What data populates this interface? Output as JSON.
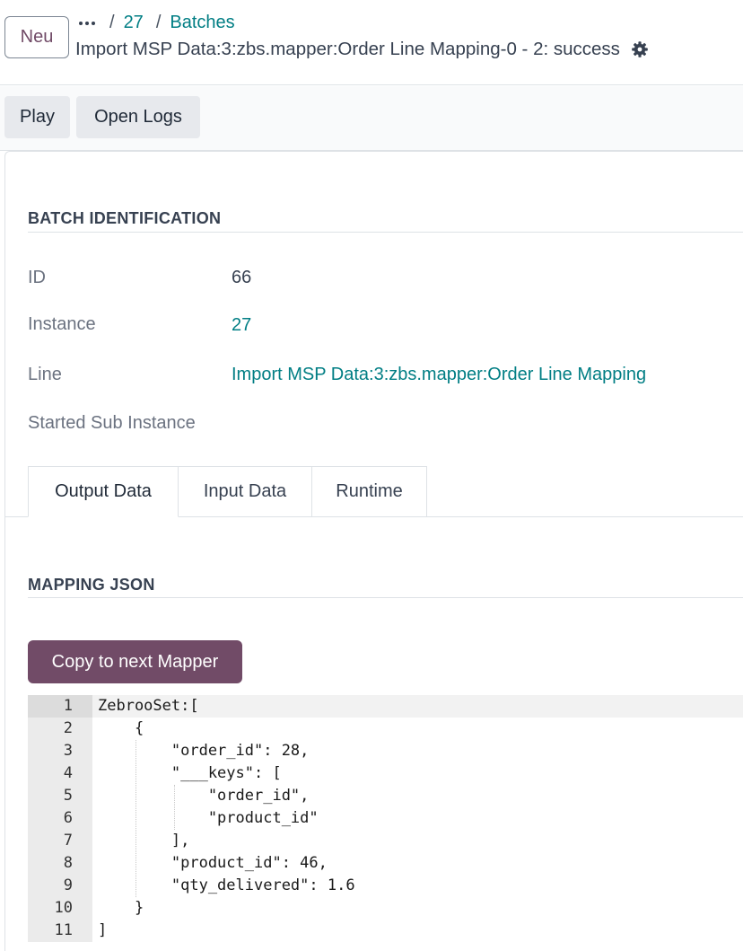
{
  "header": {
    "new_button": "Neu",
    "breadcrumb": [
      "27",
      "Batches"
    ],
    "separator": "/",
    "record_title": "Import MSP Data:3:zbs.mapper:Order Line Mapping-0 - 2: success"
  },
  "actions": {
    "play": "Play",
    "open_logs": "Open Logs"
  },
  "batch_identification": {
    "title": "BATCH IDENTIFICATION",
    "fields": [
      {
        "label": "ID",
        "value": "66"
      },
      {
        "label": "Instance",
        "value": "27"
      },
      {
        "label": "Line",
        "value": "Import MSP Data:3:zbs.mapper:Order Line Mapping"
      },
      {
        "label": "Started Sub Instance",
        "value": ""
      }
    ]
  },
  "tabs": [
    "Output Data",
    "Input Data",
    "Runtime"
  ],
  "active_tab": "Output Data",
  "mapping": {
    "title": "MAPPING JSON",
    "copy_button": "Copy to next Mapper",
    "lines": [
      "ZebrooSet:[",
      "    {",
      "        \"order_id\": 28,",
      "        \"___keys\": [",
      "            \"order_id\",",
      "            \"product_id\"",
      "        ],",
      "        \"product_id\": 46,",
      "        \"qty_delivered\": 1.6",
      "    }",
      "]"
    ]
  },
  "colors": {
    "brand": "#714B67",
    "link": "#017e84"
  }
}
